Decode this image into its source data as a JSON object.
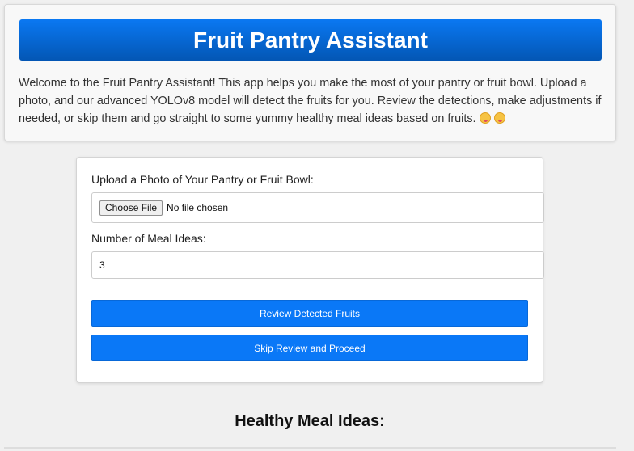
{
  "header": {
    "title": "Fruit Pantry Assistant",
    "intro": "Welcome to the Fruit Pantry Assistant! This app helps you make the most of your pantry or fruit bowl. Upload a photo, and our advanced YOLOv8 model will detect the fruits for you. Review the detections, make adjustments if needed, or skip them and go straight to some yummy healthy meal ideas based on fruits."
  },
  "form": {
    "upload_label": "Upload a Photo of Your Pantry or Fruit Bowl:",
    "choose_file_label": "Choose File",
    "no_file_text": "No file chosen",
    "meal_ideas_label": "Number of Meal Ideas:",
    "meal_ideas_value": "3",
    "review_button": "Review Detected Fruits",
    "skip_button": "Skip Review and Proceed"
  },
  "results": {
    "title": "Healthy Meal Ideas:"
  },
  "colors": {
    "accent": "#0a78f7",
    "title_bar": "#0466d0"
  },
  "icons": [
    "yum-face-emoji",
    "tongue-face-emoji"
  ]
}
